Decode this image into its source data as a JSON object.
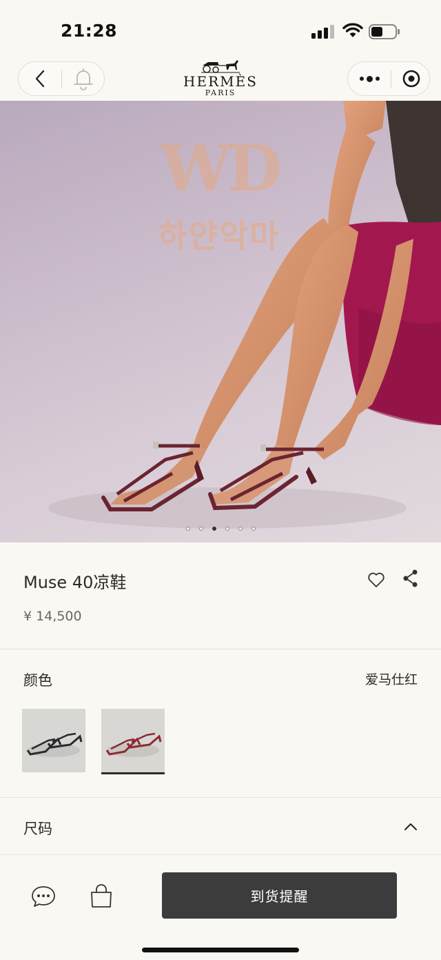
{
  "status_bar": {
    "time": "21:28"
  },
  "header": {
    "brand": "HERMÈS",
    "brand_city": "PARIS",
    "icons": [
      "back-icon",
      "bell-icon",
      "more-icon",
      "close-icon"
    ]
  },
  "hero": {
    "watermark_logo": "WD",
    "watermark_text": "하얀악마",
    "carousel": {
      "total": 6,
      "active_index": 2
    }
  },
  "product": {
    "title": "Muse 40凉鞋",
    "price": "¥ 14,500"
  },
  "color_section": {
    "label": "颜色",
    "selected_color": "爱马仕红",
    "swatches": [
      {
        "name": "black",
        "selected": false
      },
      {
        "name": "爱马仕红",
        "selected": true
      }
    ]
  },
  "size_section": {
    "label": "尺码"
  },
  "bottom_bar": {
    "notify_button": "到货提醒"
  },
  "colors": {
    "background": "#faf8f2",
    "button_dark": "#3c3c3c",
    "dress": "#a3174f",
    "sandal": "#6b2430"
  }
}
